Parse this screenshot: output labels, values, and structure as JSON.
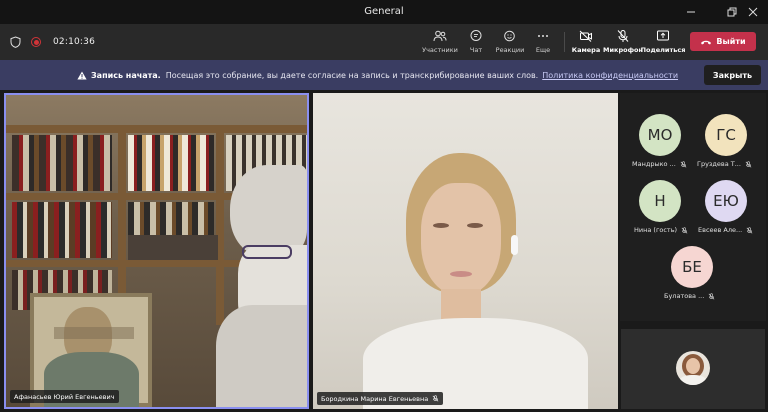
{
  "window": {
    "title": "General"
  },
  "toolbar": {
    "timer": "02:10:36",
    "participants_label": "Участники",
    "chat_label": "Чат",
    "reactions_label": "Реакции",
    "more_label": "Еще",
    "camera_label": "Камера",
    "mic_label": "Микрофон",
    "share_label": "Поделиться",
    "leave_label": "Выйти"
  },
  "banner": {
    "title": "Запись начата.",
    "message": "Посещая это собрание, вы даете согласие на запись и транскрибирование ваших слов.",
    "link": "Политика конфиденциальности",
    "close_label": "Закрыть"
  },
  "video_tiles": [
    {
      "name": "Афанасьев Юрий Евгеньевич"
    },
    {
      "name": "Бородкина Марина Евгеньевна"
    }
  ],
  "participants": [
    {
      "initials": "МО",
      "name": "Мандрыко ...",
      "color": "#d3e4c4"
    },
    {
      "initials": "ГС",
      "name": "Груздева Т...",
      "color": "#f2e3bd"
    },
    {
      "initials": "Н",
      "name": "Нина (гость)",
      "color": "#d3e4c4"
    },
    {
      "initials": "ЕЮ",
      "name": "Евсеев Але...",
      "color": "#dfd9f2"
    },
    {
      "initials": "БЕ",
      "name": "Булатова ...",
      "color": "#f6d6d2"
    }
  ],
  "colors": {
    "accent": "#8a8ff0",
    "leave": "#c4314b",
    "banner": "#3a3d62"
  }
}
